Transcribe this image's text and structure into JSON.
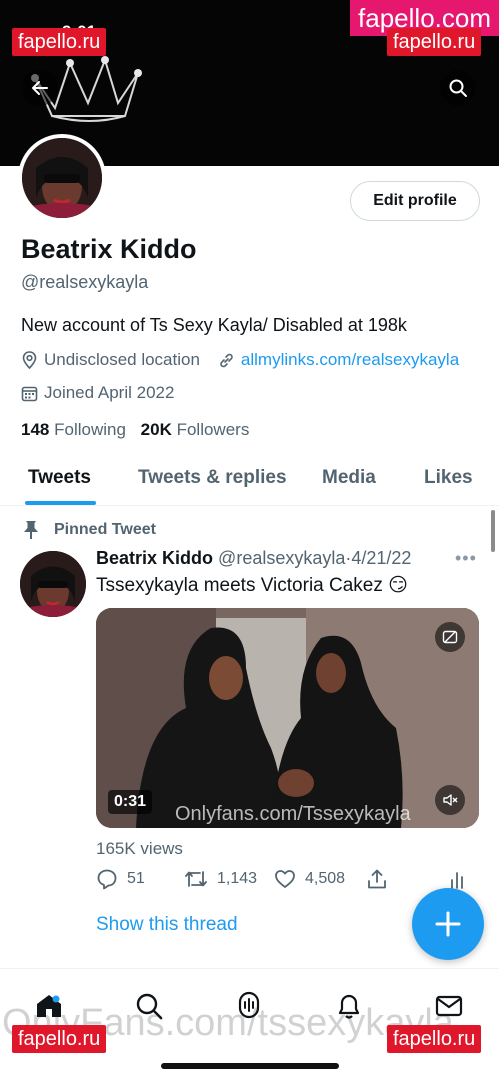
{
  "watermarks": {
    "site_top_right": "fapello.com",
    "site_tag": "fapello.ru",
    "onlyfans_footer": "OnlyFans.com/tssexykayla"
  },
  "status_bar": {
    "time": "9:01"
  },
  "header": {
    "back_icon": "arrow-left-icon",
    "search_icon": "search-icon"
  },
  "profile": {
    "display_name": "Beatrix Kiddo",
    "handle": "@realsexykayla",
    "bio": "New account of Ts Sexy Kayla/ Disabled at 198k",
    "location": "Undisclosed location",
    "link": "allmylinks.com/realsexykayla",
    "joined": "Joined April 2022",
    "following_count": "148",
    "following_label": "Following",
    "followers_count": "20K",
    "followers_label": "Followers",
    "edit_button": "Edit profile"
  },
  "tabs": [
    {
      "label": "Tweets",
      "active": true
    },
    {
      "label": "Tweets & replies",
      "active": false
    },
    {
      "label": "Media",
      "active": false
    },
    {
      "label": "Likes",
      "active": false
    }
  ],
  "tweet": {
    "pinned_label": "Pinned Tweet",
    "author_name": "Beatrix Kiddo",
    "author_handle": "@realsexykayla",
    "separator": "·",
    "date": "4/21/22",
    "text": "Tssexykayla meets Victoria Cakez 😏",
    "video_duration": "0:31",
    "video_watermark": "Onlyfans.com/Tssexykayla",
    "views": "165K views",
    "replies": "51",
    "retweets": "1,143",
    "likes": "4,508",
    "show_thread": "Show this thread"
  },
  "colors": {
    "accent": "#1d9bf0",
    "text_primary": "#0f1419",
    "text_secondary": "#536471"
  }
}
